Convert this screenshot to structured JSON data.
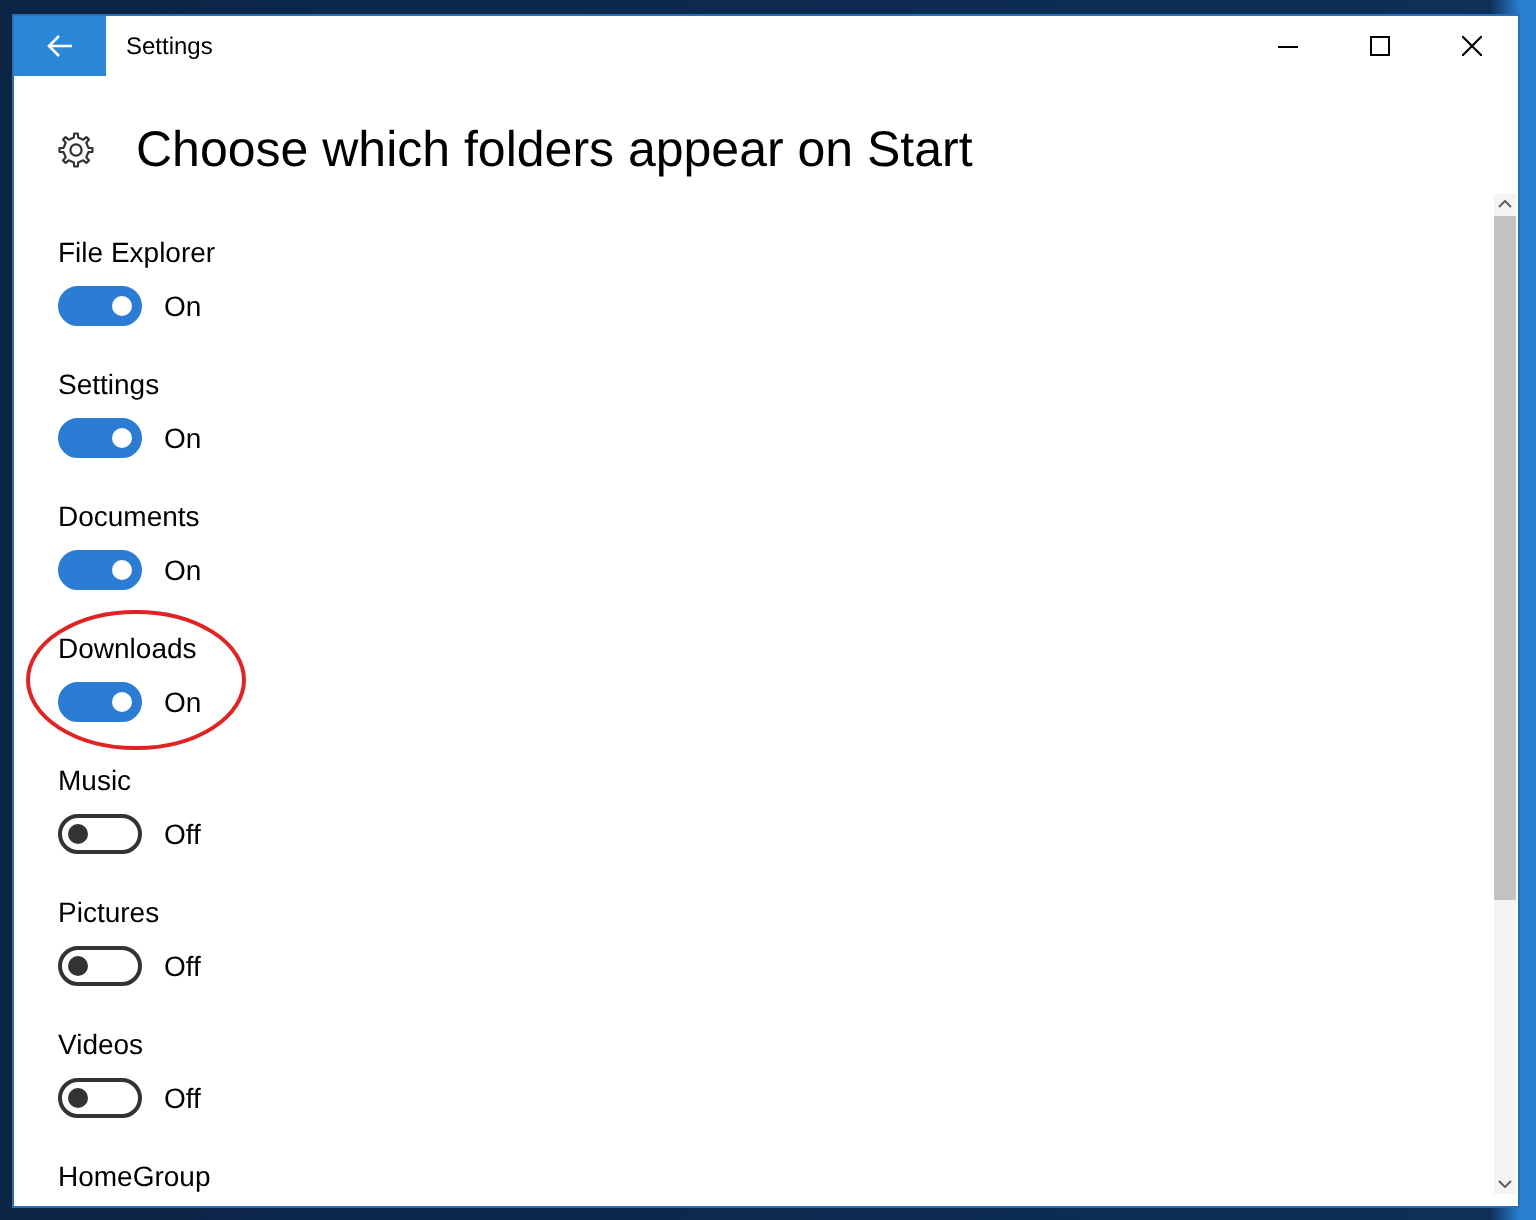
{
  "window": {
    "title": "Settings"
  },
  "page": {
    "heading": "Choose which folders appear on Start"
  },
  "folders": [
    {
      "label": "File Explorer",
      "on": true,
      "state_text": "On",
      "circled": false
    },
    {
      "label": "Settings",
      "on": true,
      "state_text": "On",
      "circled": false
    },
    {
      "label": "Documents",
      "on": true,
      "state_text": "On",
      "circled": false
    },
    {
      "label": "Downloads",
      "on": true,
      "state_text": "On",
      "circled": true
    },
    {
      "label": "Music",
      "on": false,
      "state_text": "Off",
      "circled": false
    },
    {
      "label": "Pictures",
      "on": false,
      "state_text": "Off",
      "circled": false
    },
    {
      "label": "Videos",
      "on": false,
      "state_text": "Off",
      "circled": false
    },
    {
      "label": "HomeGroup",
      "circled": false
    }
  ]
}
